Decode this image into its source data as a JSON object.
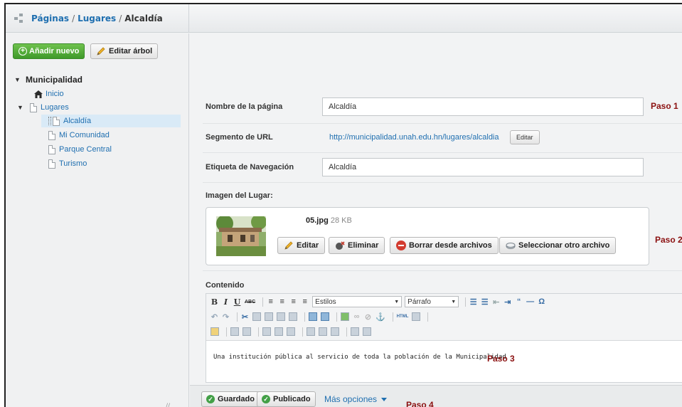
{
  "breadcrumb": {
    "parent1": "Páginas",
    "sep": "/",
    "parent2": "Lugares",
    "current": "Alcaldía"
  },
  "sidebar": {
    "add_button": "Añadir nuevo",
    "edit_tree_button": "Editar árbol",
    "tree": {
      "root": "Municipalidad",
      "home": "Inicio",
      "lugares": "Lugares",
      "children": [
        "Alcaldía",
        "Mi Comunidad",
        "Parque Central",
        "Turismo"
      ]
    }
  },
  "form": {
    "page_name_label": "Nombre de la página",
    "page_name_value": "Alcaldía",
    "url_label": "Segmento de URL",
    "url_value": "http://municipalidad.unah.edu.hn/lugares/alcaldia",
    "url_edit_button": "Editar",
    "nav_label": "Etiqueta de Navegación",
    "nav_value": "Alcaldía",
    "image_label": "Imagen del Lugar:",
    "image": {
      "filename": "05.jpg",
      "size": "28 KB",
      "edit_button": "Editar",
      "delete_button": "Eliminar",
      "remove_button": "Borrar desde archivos",
      "select_button": "Seleccionar otro archivo"
    },
    "content_label": "Contenido",
    "editor": {
      "styles_select": "Estilos",
      "format_select": "Párrafo",
      "text": "Una institución pública al servicio de toda la población de la Municipalidad"
    }
  },
  "steps": {
    "paso1": "Paso 1",
    "paso2": "Paso 2",
    "paso3": "Paso 3",
    "paso4": "Paso 4"
  },
  "actions": {
    "save_button": "Guardado",
    "publish_button": "Publicado",
    "more_options": "Más opciones"
  }
}
